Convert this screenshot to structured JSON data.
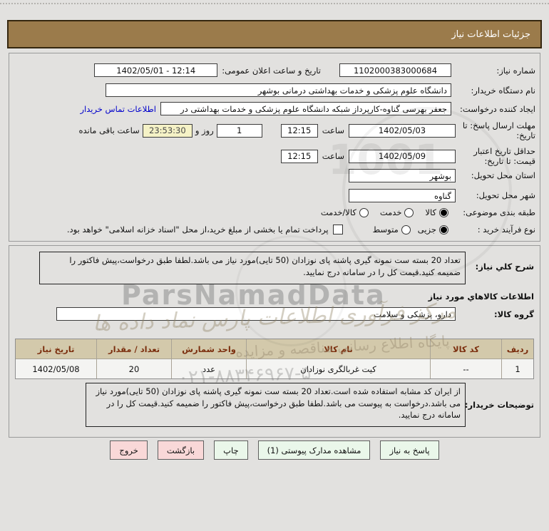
{
  "title_bar": "جزئیات اطلاعات نیاز",
  "form": {
    "need_number": {
      "label": "شماره نیاز:",
      "value": "1102000383000684"
    },
    "announce": {
      "label": "تاریخ و ساعت اعلان عمومی:",
      "value": "1402/05/01 - 12:14"
    },
    "buyer_org": {
      "label": "نام دستگاه خریدار:",
      "value": "دانشگاه علوم پزشکی و خدمات بهداشتی درمانی بوشهر"
    },
    "request_creator": {
      "label": "ایجاد کننده درخواست:",
      "value": "جعفر بهرسی گناوه-کارپرداز شبکه دانشگاه علوم پزشکی و خدمات بهداشتی در",
      "contact_link": "اطلاعات تماس خریدار"
    },
    "response_deadline": {
      "label": "مهلت ارسال پاسخ: تا تاریخ:",
      "date": "1402/05/03",
      "hour_label": "ساعت",
      "hour": "12:15",
      "days_value": "1",
      "days_label": "روز و",
      "countdown": "23:53:30",
      "countdown_label": "ساعت باقی مانده"
    },
    "price_validity": {
      "label": "حداقل تاریخ اعتبار قیمت: تا تاریخ:",
      "date": "1402/05/09",
      "hour_label": "ساعت",
      "hour": "12:15"
    },
    "province": {
      "label": "استان محل تحویل:",
      "value": "بوشهر"
    },
    "city": {
      "label": "شهر محل تحویل:",
      "value": "گناوه"
    },
    "classification": {
      "label": "طبقه بندی موضوعی:",
      "options": [
        {
          "label": "کالا",
          "selected": true
        },
        {
          "label": "خدمت",
          "selected": false
        },
        {
          "label": "کالا/خدمت",
          "selected": false
        }
      ]
    },
    "purchase_type": {
      "label": "نوع فرآیند خرید :",
      "options": [
        {
          "label": "جزیی",
          "selected": true
        },
        {
          "label": "متوسط",
          "selected": false
        }
      ],
      "checkbox_label": "پرداخت تمام یا بخشی از مبلغ خرید،از محل \"اسناد خزانه اسلامی\" خواهد بود.",
      "checkbox_checked": false
    }
  },
  "need_section": {
    "description": {
      "label": "شرح کلي نیاز:",
      "value": "تعداد 20 بسته ست نمونه گیری پاشنه پای نوزادان (50 تایی)مورد نیاز می باشد.لطفا طبق درخواست،پیش فاکتور را ضمیمه کنید.قیمت کل را در سامانه درج نمایید."
    },
    "goods_header": "اطلاعات کالاهاي مورد نیاز",
    "goods_group": {
      "label": "گروه کالا:",
      "value": "دارو، پزشکی و سلامت"
    },
    "table": {
      "headers": [
        "ردیف",
        "کد کالا",
        "نام کالا",
        "واحد شمارش",
        "تعداد / مقدار",
        "تاریخ نیاز"
      ],
      "rows": [
        [
          "1",
          "--",
          "کیت غربالگری نوزادان",
          "عدد",
          "20",
          "1402/05/08"
        ]
      ]
    },
    "buyer_notes": {
      "label": "توضیحات خریدار:",
      "value": "از ایران کد مشابه استفاده شده است.تعداد 20 بسته ست نمونه گیری پاشنه پای نوزادان (50 تایی)مورد نیاز می باشد.درخواست به پیوست می باشد.لطفا طبق درخواست،پیش فاکتور را ضمیمه کنید.قیمت کل را در سامانه درج نمایید."
    }
  },
  "buttons": [
    {
      "label": "پاسخ به نیاز",
      "style": "green"
    },
    {
      "label": "مشاهده مدارک پیوستی (1)",
      "style": "green"
    },
    {
      "label": "چاپ",
      "style": "green"
    },
    {
      "label": "بازگشت",
      "style": "red"
    },
    {
      "label": "خروج",
      "style": "red"
    }
  ],
  "watermark": {
    "brand_latin": "ParsNamadData",
    "brand_persian": "مرکز فرآوری اطلاعات پارس نماد داده ها",
    "site_line": "پایگاه اطلاع رسانی مناقصه و مزایده",
    "phone": "۰۲۱-۸۸۳۴۶۹۶۷-۵",
    "digits": "1001"
  },
  "colors": {
    "title_bar_bg": "#9b7b4b",
    "page_bg": "#e2e1df",
    "table_header_bg": "#d3c9ab",
    "table_header_text": "#7b2e0e",
    "button_green": "#eaf7ea",
    "button_red": "#f9d8d8",
    "countdown_bg": "#f5f2c6",
    "link": "#0000cc"
  }
}
